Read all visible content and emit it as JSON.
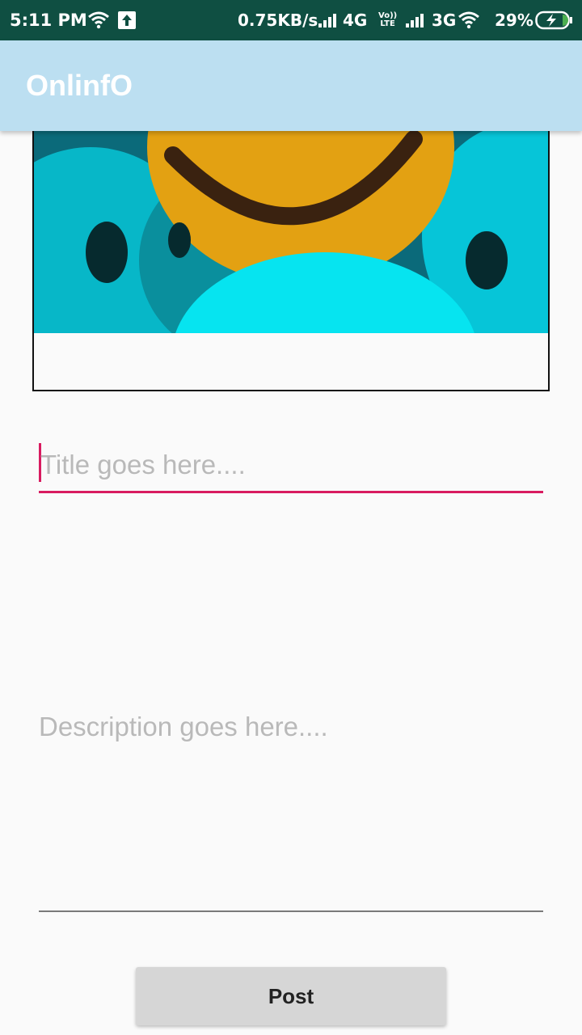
{
  "status_bar": {
    "time": "5:11 PM",
    "network_speed": "0.75KB/s",
    "network_1": "4G",
    "volte_top": "Vo))",
    "volte_bottom": "LTE",
    "network_2": "3G",
    "battery_percent": "29%"
  },
  "app_bar": {
    "title": "OnlinfO",
    "background_color": "#bcdff1"
  },
  "form": {
    "title_placeholder": "Title goes here....",
    "title_value": "",
    "description_placeholder": "Description goes here....",
    "description_value": "",
    "accent_color": "#d81b60",
    "post_label": "Post"
  }
}
